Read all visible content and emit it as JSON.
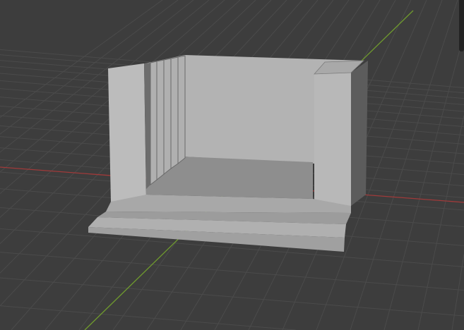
{
  "viewport": {
    "background": "#3d3d3d",
    "grid_color": "#4b4b4b",
    "x_axis_color": "#a03a3a",
    "y_axis_color": "#6f9a2e",
    "model_light": "#b6b6b6",
    "model_mid": "#9a9a9a",
    "model_dark": "#5c5c5c"
  }
}
